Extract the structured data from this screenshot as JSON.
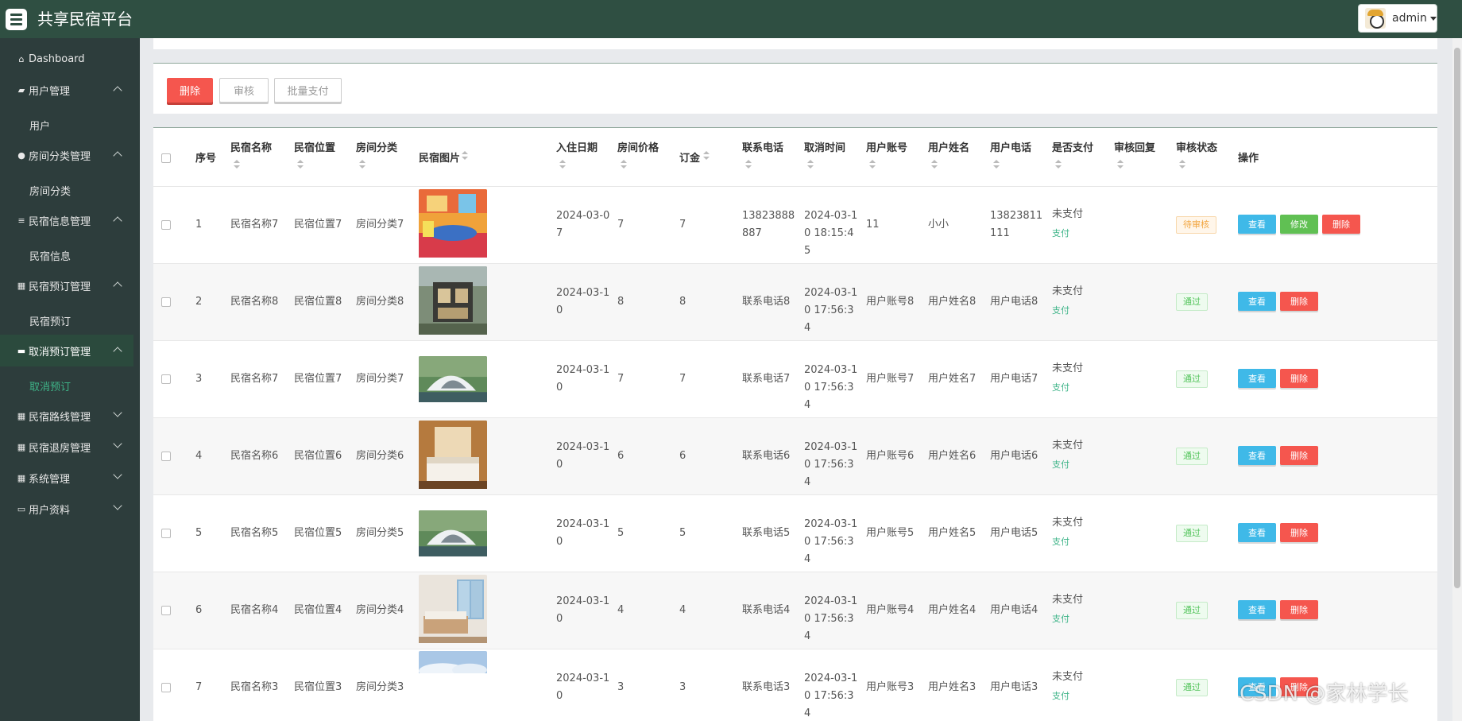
{
  "app": {
    "title": "共享民宿平台",
    "user": "admin"
  },
  "sidebar": {
    "items": [
      {
        "label": "Dashboard",
        "icon": "home-icon"
      },
      {
        "label": "用户管理",
        "icon": "edit-icon",
        "expanded": true,
        "sub": "用户"
      },
      {
        "label": "房间分类管理",
        "icon": "user-icon",
        "expanded": true,
        "sub": "房间分类"
      },
      {
        "label": "民宿信息管理",
        "icon": "list-icon",
        "expanded": true,
        "sub": "民宿信息"
      },
      {
        "label": "民宿预订管理",
        "icon": "grid-icon",
        "expanded": true,
        "sub": "民宿预订"
      },
      {
        "label": "取消预订管理",
        "icon": "ticket-icon",
        "expanded": true,
        "active": true,
        "sub": "取消预订"
      },
      {
        "label": "民宿路线管理",
        "icon": "grid-icon",
        "expanded": false
      },
      {
        "label": "民宿退房管理",
        "icon": "grid-icon",
        "expanded": false
      },
      {
        "label": "系统管理",
        "icon": "grid-icon",
        "expanded": false
      },
      {
        "label": "用户资料",
        "icon": "card-icon",
        "expanded": false
      }
    ]
  },
  "toolbar": {
    "delete_label": "删除",
    "audit_label": "审核",
    "batch_pay_label": "批量支付"
  },
  "table": {
    "headers": {
      "index": "序号",
      "name": "民宿名称",
      "location": "民宿位置",
      "category": "房间分类",
      "image": "民宿图片",
      "checkin": "入住日期",
      "price": "房间价格",
      "deposit": "订金",
      "phone": "联系电话",
      "cancel_time": "取消时间",
      "account": "用户账号",
      "username": "用户姓名",
      "user_phone": "用户电话",
      "paid": "是否支付",
      "reply": "审核回复",
      "status": "审核状态",
      "actions": "操作"
    },
    "rows": [
      {
        "index": "1",
        "name": "民宿名称7",
        "location": "民宿位置7",
        "category": "房间分类7",
        "checkin": "2024-03-07",
        "price": "7",
        "deposit": "7",
        "phone": "13823888887",
        "cancel_time": "2024-03-10 18:15:45",
        "account": "11",
        "username": "小小",
        "user_phone": "13823811111",
        "paid": "未支付",
        "pay_link": "支付",
        "status": "待审核",
        "status_type": "wait",
        "image": "room-colorful"
      },
      {
        "index": "2",
        "name": "民宿名称8",
        "location": "民宿位置8",
        "category": "房间分类8",
        "checkin": "2024-03-10",
        "price": "8",
        "deposit": "8",
        "phone": "联系电话8",
        "cancel_time": "2024-03-10 17:56:34",
        "account": "用户账号8",
        "username": "用户姓名8",
        "user_phone": "用户电话8",
        "paid": "未支付",
        "pay_link": "支付",
        "status": "通过",
        "status_type": "pass",
        "image": "house-modern"
      },
      {
        "index": "3",
        "name": "民宿名称7",
        "location": "民宿位置7",
        "category": "房间分类7",
        "checkin": "2024-03-10",
        "price": "7",
        "deposit": "7",
        "phone": "联系电话7",
        "cancel_time": "2024-03-10 17:56:34",
        "account": "用户账号7",
        "username": "用户姓名7",
        "user_phone": "用户电话7",
        "paid": "未支付",
        "pay_link": "支付",
        "status": "通过",
        "status_type": "pass",
        "image": "dome-lake"
      },
      {
        "index": "4",
        "name": "民宿名称6",
        "location": "民宿位置6",
        "category": "房间分类6",
        "checkin": "2024-03-10",
        "price": "6",
        "deposit": "6",
        "phone": "联系电话6",
        "cancel_time": "2024-03-10 17:56:34",
        "account": "用户账号6",
        "username": "用户姓名6",
        "user_phone": "用户电话6",
        "paid": "未支付",
        "pay_link": "支付",
        "status": "通过",
        "status_type": "pass",
        "image": "bedroom-warm"
      },
      {
        "index": "5",
        "name": "民宿名称5",
        "location": "民宿位置5",
        "category": "房间分类5",
        "checkin": "2024-03-10",
        "price": "5",
        "deposit": "5",
        "phone": "联系电话5",
        "cancel_time": "2024-03-10 17:56:34",
        "account": "用户账号5",
        "username": "用户姓名5",
        "user_phone": "用户电话5",
        "paid": "未支付",
        "pay_link": "支付",
        "status": "通过",
        "status_type": "pass",
        "image": "dome-lake"
      },
      {
        "index": "6",
        "name": "民宿名称4",
        "location": "民宿位置4",
        "category": "房间分类4",
        "checkin": "2024-03-10",
        "price": "4",
        "deposit": "4",
        "phone": "联系电话4",
        "cancel_time": "2024-03-10 17:56:34",
        "account": "用户账号4",
        "username": "用户姓名4",
        "user_phone": "用户电话4",
        "paid": "未支付",
        "pay_link": "支付",
        "status": "通过",
        "status_type": "pass",
        "image": "bedroom-bright"
      },
      {
        "index": "7",
        "name": "民宿名称3",
        "location": "民宿位置3",
        "category": "房间分类3",
        "checkin": "2024-03-10",
        "price": "3",
        "deposit": "3",
        "phone": "联系电话3",
        "cancel_time": "2024-03-10 17:56:34",
        "account": "用户账号3",
        "username": "用户姓名3",
        "user_phone": "用户电话3",
        "paid": "未支付",
        "pay_link": "支付",
        "status": "通过",
        "status_type": "pass",
        "image": "sky"
      }
    ],
    "actions": {
      "view": "查看",
      "edit": "修改",
      "delete": "删除"
    }
  },
  "watermark": "CSDN @家林学长",
  "colors": {
    "topbar": "#2f4f42",
    "sidebar": "#2d3d3c",
    "accent": "#3eb488",
    "danger": "#f5564e",
    "info": "#3fb9e8",
    "success": "#60c053"
  }
}
